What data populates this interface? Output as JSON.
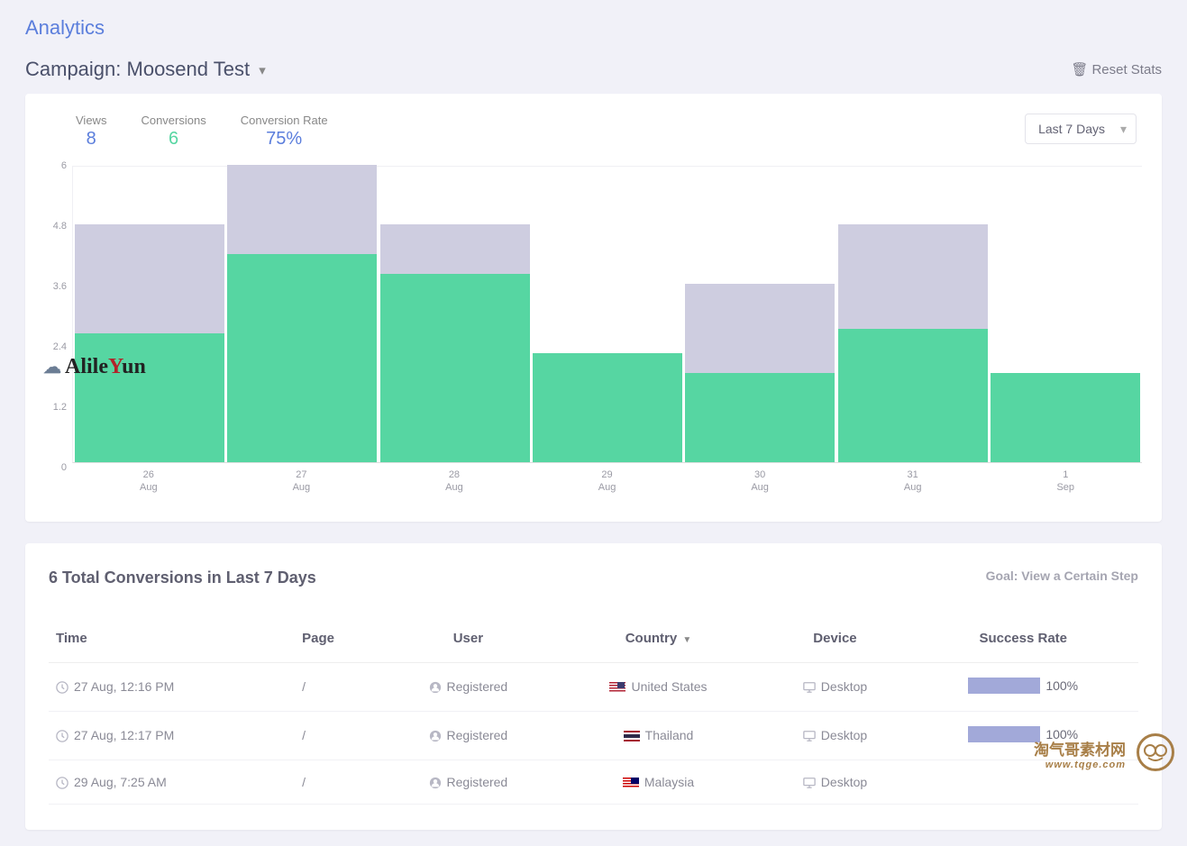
{
  "page_title": "Analytics",
  "campaign": {
    "label": "Campaign: Moosend Test"
  },
  "actions": {
    "reset": "Reset Stats"
  },
  "stats": {
    "views_label": "Views",
    "views_value": "8",
    "conv_label": "Conversions",
    "conv_value": "6",
    "rate_label": "Conversion Rate",
    "rate_value": "75%"
  },
  "range_dropdown": {
    "selected": "Last 7 Days"
  },
  "chart_data": {
    "type": "bar",
    "ylim": [
      0,
      6
    ],
    "yticks": [
      0,
      1.2,
      2.4,
      3.6,
      4.8,
      6
    ],
    "categories": [
      "26 Aug",
      "27 Aug",
      "28 Aug",
      "29 Aug",
      "30 Aug",
      "31 Aug",
      "1 Sep"
    ],
    "x_day": [
      "26",
      "27",
      "28",
      "29",
      "30",
      "31",
      "1"
    ],
    "x_month": [
      "Aug",
      "Aug",
      "Aug",
      "Aug",
      "Aug",
      "Aug",
      "Sep"
    ],
    "series": [
      {
        "name": "Conversions",
        "values": [
          2.6,
          4.2,
          3.8,
          2.2,
          1.8,
          2.7,
          1.8
        ]
      },
      {
        "name": "Views",
        "values": [
          4.8,
          6.0,
          4.8,
          2.2,
          3.6,
          4.8,
          1.8
        ]
      }
    ]
  },
  "conversions_panel": {
    "title": "6 Total Conversions in Last 7 Days",
    "goal": "Goal: View a Certain Step",
    "columns": {
      "time": "Time",
      "page": "Page",
      "user": "User",
      "country": "Country",
      "device": "Device",
      "rate": "Success Rate"
    },
    "rows": [
      {
        "time": "27 Aug, 12:16 PM",
        "page": "/",
        "user": "Registered",
        "country": "United States",
        "flag": "us",
        "device": "Desktop",
        "rate": 100
      },
      {
        "time": "27 Aug, 12:17 PM",
        "page": "/",
        "user": "Registered",
        "country": "Thailand",
        "flag": "th",
        "device": "Desktop",
        "rate": 100
      },
      {
        "time": "29 Aug, 7:25 AM",
        "page": "/",
        "user": "Registered",
        "country": "Malaysia",
        "flag": "my",
        "device": "Desktop",
        "rate": null
      }
    ]
  },
  "watermark1": "AlileYun",
  "watermark2": {
    "line1": "淘气哥素材网",
    "line2": "www.tqge.com"
  }
}
